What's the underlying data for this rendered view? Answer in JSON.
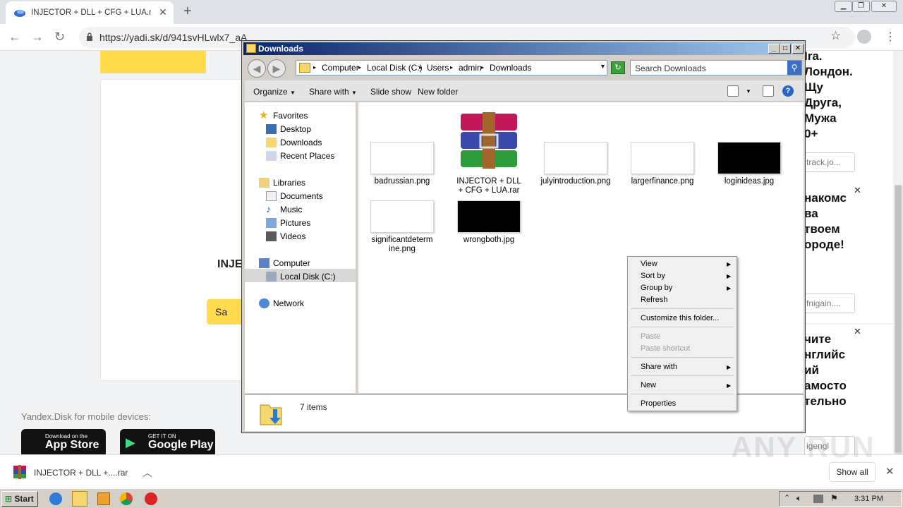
{
  "browser": {
    "tab_title": "INJECTOR + DLL + CFG + LUA.rar –",
    "url": "https://yadi.sk/d/941svHLwlx7_aA"
  },
  "page": {
    "file_title_fragment": "INJE",
    "save_button": "Sa",
    "mobile_label": "Yandex.Disk for mobile devices:",
    "app_store_small": "Download on the",
    "app_store_big": "App Store",
    "google_small": "GET IT ON",
    "google_big": "Google Play"
  },
  "ads": [
    {
      "text": "Ira.\nЛондон.\nЩу\nДруга,\nМужа\n0+",
      "button": "track.jo..."
    },
    {
      "text": "накомс\nва\nтвоем\nороде!",
      "button": "fnigain...."
    },
    {
      "text": "чите\nнглийс\nий\nамосто\nтельно",
      "button": "igengl"
    }
  ],
  "explorer": {
    "title": "Downloads",
    "breadcrumbs": [
      "Computer",
      "Local Disk (C:)",
      "Users",
      "admin",
      "Downloads"
    ],
    "search_placeholder": "Search Downloads",
    "commands": {
      "organize": "Organize",
      "share": "Share with",
      "slideshow": "Slide show",
      "newfolder": "New folder"
    },
    "nav": {
      "favorites": "Favorites",
      "desktop": "Desktop",
      "downloads": "Downloads",
      "recent": "Recent Places",
      "libraries": "Libraries",
      "documents": "Documents",
      "music": "Music",
      "pictures": "Pictures",
      "videos": "Videos",
      "computer": "Computer",
      "localdisk": "Local Disk (C:)",
      "network": "Network"
    },
    "files": [
      "badrussian.png",
      "INJECTOR + DLL + CFG + LUA.rar",
      "julyintroduction.png",
      "largerfinance.png",
      "loginideas.jpg",
      "significantdetermine.png",
      "wrongboth.jpg"
    ],
    "status": "7 items"
  },
  "context_menu": {
    "view": "View",
    "sortby": "Sort by",
    "groupby": "Group by",
    "refresh": "Refresh",
    "customize": "Customize this folder...",
    "paste": "Paste",
    "paste_shortcut": "Paste shortcut",
    "sharewith": "Share with",
    "new": "New",
    "properties": "Properties"
  },
  "download_bar": {
    "item": "INJECTOR + DLL +....rar",
    "show_all": "Show all"
  },
  "taskbar": {
    "start": "Start",
    "time": "3:31 PM"
  },
  "watermark": "ANY RUN"
}
